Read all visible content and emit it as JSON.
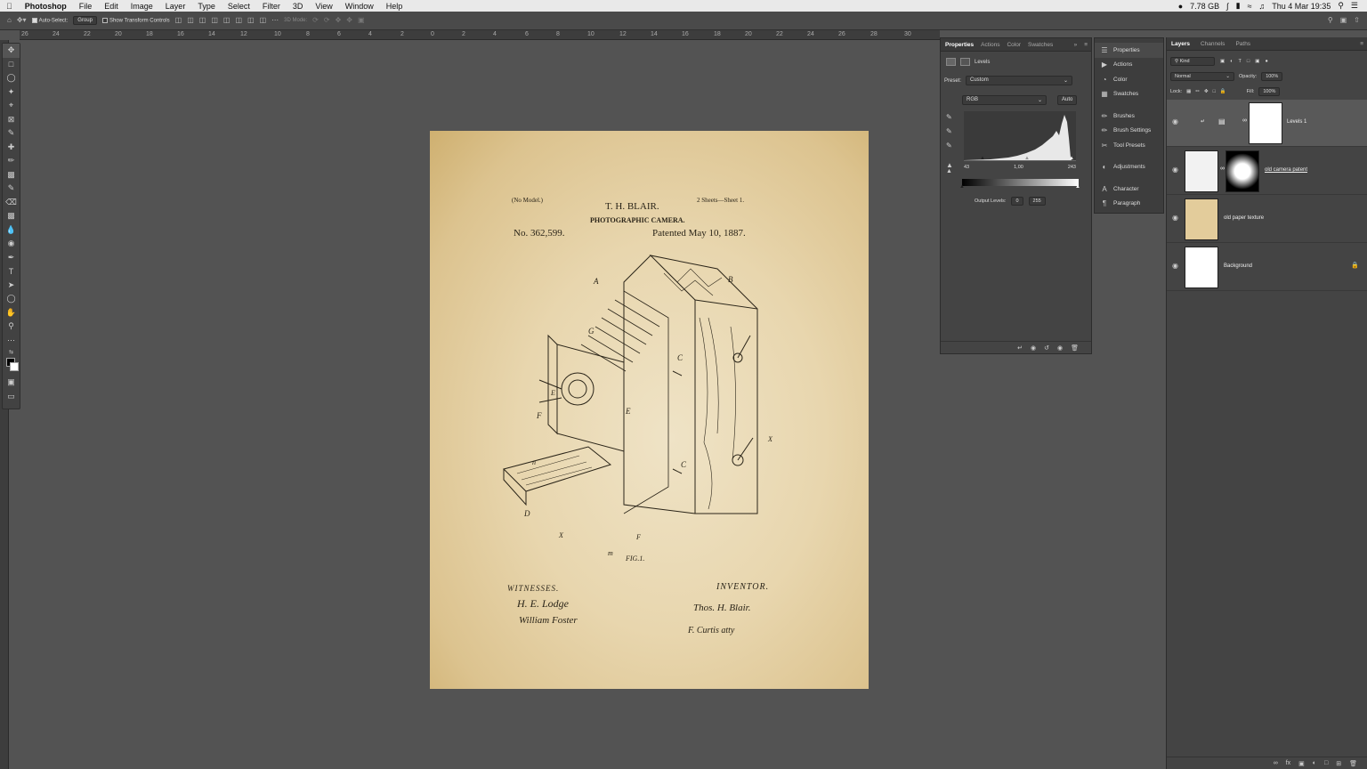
{
  "menubar": {
    "app": "Photoshop",
    "items": [
      "File",
      "Edit",
      "Image",
      "Layer",
      "Type",
      "Select",
      "Filter",
      "3D",
      "View",
      "Window",
      "Help"
    ],
    "memory": "7.78 GB",
    "datetime": "Thu 4 Mar  19:35"
  },
  "options": {
    "auto_select_label": "Auto-Select:",
    "auto_select_value": "Group",
    "transform_label": "Show Transform Controls",
    "mode_3d": "3D Mode:"
  },
  "ruler": {
    "ticks": [
      "26",
      "24",
      "22",
      "20",
      "18",
      "16",
      "14",
      "12",
      "10",
      "8",
      "6",
      "4",
      "2",
      "0",
      "2",
      "4",
      "6",
      "8",
      "10",
      "12",
      "14",
      "16",
      "18",
      "20",
      "22",
      "24",
      "26",
      "28",
      "30"
    ]
  },
  "document": {
    "no_model": "(No Model.)",
    "inventor_name": "T. H. BLAIR.",
    "sheets": "2 Sheets—Sheet 1.",
    "subject": "PHOTOGRAPHIC CAMERA.",
    "patent_no": "No. 362,599.",
    "patented": "Patented May 10, 1887.",
    "fig": "FIG.1.",
    "witnesses": "WITNESSES.",
    "inventor_label": "INVENTOR.",
    "sig_w1": "H. E. Lodge",
    "sig_w2": "William Foster",
    "sig_inv": "Thos. H. Blair.",
    "sig_atty": "F. Curtis atty",
    "letters": [
      "A",
      "B",
      "G",
      "C",
      "C",
      "F",
      "E",
      "D",
      "X",
      "X",
      "n",
      "m",
      "F",
      "E"
    ]
  },
  "properties": {
    "tabs": [
      "Properties",
      "Actions",
      "Color",
      "Swatches"
    ],
    "type": "Levels",
    "preset_label": "Preset:",
    "preset_value": "Custom",
    "channel": "RGB",
    "auto": "Auto",
    "input_black": "43",
    "input_mid": "1,00",
    "input_white": "243",
    "output_label": "Output Levels:",
    "output_black": "0",
    "output_white": "255"
  },
  "dock": {
    "items": [
      "Properties",
      "Actions",
      "Color",
      "Swatches",
      "Brushes",
      "Brush Settings",
      "Tool Presets",
      "Adjustments",
      "Character",
      "Paragraph"
    ]
  },
  "layers_panel": {
    "tabs": [
      "Layers",
      "Channels",
      "Paths"
    ],
    "kind": "Kind",
    "blend": "Normal",
    "opacity_label": "Opacity:",
    "opacity": "100%",
    "lock_label": "Lock:",
    "fill_label": "Fill:",
    "fill": "100%",
    "layers": [
      {
        "name": "Levels 1"
      },
      {
        "name": "old camera patent"
      },
      {
        "name": "old paper texture"
      },
      {
        "name": "Background"
      }
    ]
  },
  "colors": {
    "accent": "#ffffff",
    "panel": "#444444",
    "canvas": "#535353"
  }
}
